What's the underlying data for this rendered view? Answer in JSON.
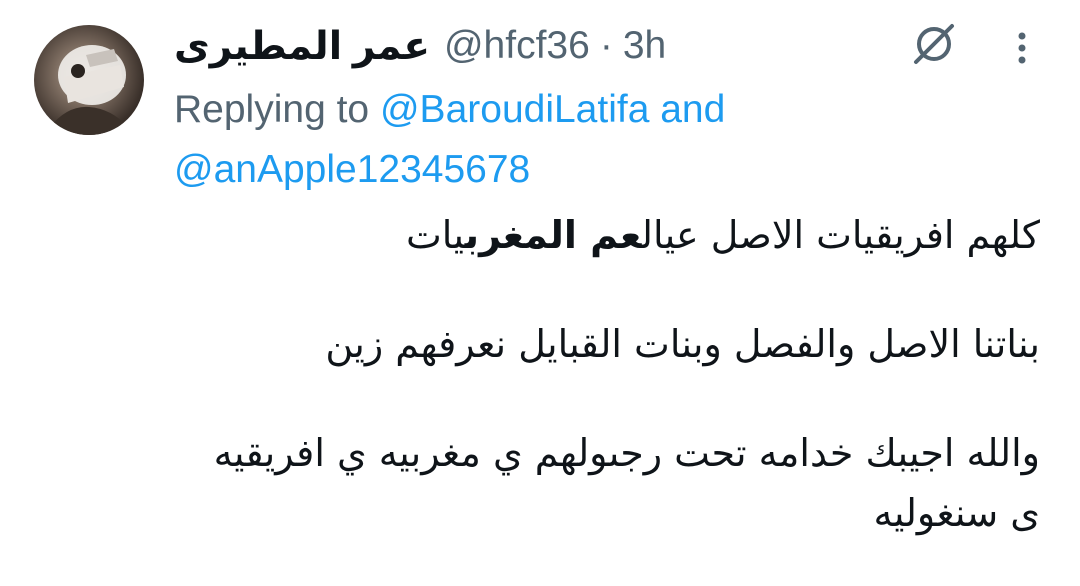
{
  "author": {
    "name": "عمر المطيرى",
    "handle": "@hfcf36",
    "separator": "·",
    "time": "3h"
  },
  "reply": {
    "prefix": "Replying to",
    "mention1": "@BaroudiLatifa",
    "connector": "and",
    "mention2": "@anApple12345678"
  },
  "tweet": {
    "line1_start": "كلهم افريقيات الاصل عيال",
    "line1_bold": "عم المغرب",
    "line1_end": "يات",
    "line2": "بناتنا الاصل والفصل وبنات القبايل نعرفهم زين",
    "line3": "والله اجيبك خدامه تحت رجىولهم ي مغربيه ي افريقيه",
    "line4": "ى سنغوليه"
  },
  "icons": {
    "status": "no-sign-icon",
    "menu": "more-vertical-icon"
  },
  "colors": {
    "accent": "#1d9bf0",
    "secondary_text": "#536471",
    "primary_text": "#0f1419"
  }
}
